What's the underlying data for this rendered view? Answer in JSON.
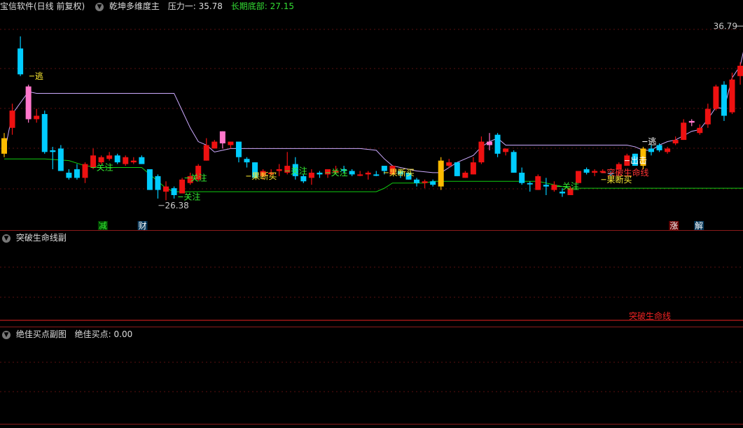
{
  "header": {
    "app_title": "宝信软件(日线 前复权)",
    "indicator_name": "乾坤多维度主",
    "pressure_label": "压力一:",
    "pressure_value": "35.78",
    "bottom_label": "长期底部:",
    "bottom_value": "27.15"
  },
  "sub1": {
    "title": "突破生命线副",
    "label": "突破生命线"
  },
  "sub2": {
    "title": "绝佳买点副图",
    "buy_label": "绝佳买点:",
    "buy_value": "0.00"
  },
  "colors": {
    "up": "#ee1111",
    "down": "#00ccff",
    "pink": "#ff77cc",
    "yellow": "#ffbb00",
    "life_line": "#11cc11",
    "upper_line": "#ccaaff",
    "pressure": "#dddddd",
    "bottom": "#33dd33",
    "guanzhu": "#33ee33",
    "guoduan": "#ffee33",
    "tupo": "#ff3333"
  },
  "chart_data": {
    "type": "candlestick",
    "y_range": [
      25.6,
      37.6
    ],
    "max_label": "36.79",
    "min_label": "26.38",
    "candles": [
      [
        29.5,
        30.4,
        30.7,
        29.3,
        "yellow"
      ],
      [
        31.0,
        32.0,
        32.4,
        30.6,
        "up"
      ],
      [
        35.6,
        34.1,
        36.3,
        34.0,
        "down"
      ],
      [
        33.4,
        31.5,
        33.5,
        31.3,
        "pink"
      ],
      [
        31.7,
        31.5,
        32.1,
        31.3,
        "up"
      ],
      [
        31.8,
        29.6,
        32.0,
        29.5,
        "down"
      ],
      [
        29.7,
        29.6,
        29.9,
        28.6,
        "down"
      ],
      [
        29.8,
        28.5,
        30.0,
        28.5,
        "down"
      ],
      [
        28.4,
        28.1,
        28.6,
        28.0,
        "down"
      ],
      [
        28.1,
        28.6,
        28.9,
        28.0,
        "down"
      ],
      [
        28.1,
        28.9,
        29.0,
        27.8,
        "up"
      ],
      [
        28.7,
        29.4,
        29.8,
        28.6,
        "up"
      ],
      [
        29.0,
        29.3,
        29.4,
        28.9,
        "up"
      ],
      [
        29.2,
        29.4,
        29.6,
        29.1,
        "up"
      ],
      [
        29.4,
        29.0,
        29.5,
        28.9,
        "down"
      ],
      [
        28.9,
        29.3,
        29.4,
        28.8,
        "up"
      ],
      [
        29.1,
        29.0,
        29.3,
        28.9,
        "up"
      ],
      [
        29.3,
        28.9,
        29.4,
        28.9,
        "down"
      ],
      [
        28.6,
        27.4,
        28.6,
        27.4,
        "down"
      ],
      [
        28.2,
        27.4,
        28.3,
        26.9,
        "down"
      ],
      [
        27.3,
        27.6,
        27.9,
        26.8,
        "up"
      ],
      [
        27.5,
        27.1,
        27.6,
        26.9,
        "down"
      ],
      [
        27.2,
        28.0,
        28.1,
        27.2,
        "up"
      ],
      [
        27.8,
        28.2,
        28.4,
        27.7,
        "up"
      ],
      [
        28.0,
        28.8,
        28.9,
        27.9,
        "up"
      ],
      [
        29.1,
        30.0,
        30.4,
        29.1,
        "up"
      ],
      [
        29.8,
        30.2,
        30.3,
        29.8,
        "up"
      ],
      [
        30.1,
        30.8,
        30.8,
        29.8,
        "pink"
      ],
      [
        30.2,
        30.0,
        30.2,
        29.8,
        "up"
      ],
      [
        30.2,
        29.3,
        30.2,
        29.0,
        "down"
      ],
      [
        29.2,
        29.0,
        29.3,
        28.7,
        "down"
      ],
      [
        29.0,
        28.1,
        29.0,
        28.1,
        "down"
      ],
      [
        28.2,
        28.5,
        28.6,
        28.0,
        "up"
      ],
      [
        28.4,
        28.4,
        28.6,
        28.2,
        "up"
      ],
      [
        28.5,
        28.6,
        28.9,
        28.2,
        "up"
      ],
      [
        28.8,
        28.4,
        29.6,
        28.3,
        "up"
      ],
      [
        28.2,
        28.9,
        29.3,
        28.0,
        "down"
      ],
      [
        28.2,
        27.9,
        28.3,
        27.8,
        "down"
      ],
      [
        28.1,
        28.4,
        28.6,
        27.7,
        "up"
      ],
      [
        28.4,
        28.3,
        28.5,
        28.1,
        "down"
      ],
      [
        28.3,
        28.6,
        28.6,
        28.1,
        "up"
      ],
      [
        28.5,
        28.5,
        28.8,
        28.3,
        "up"
      ],
      [
        28.6,
        28.5,
        28.8,
        28.4,
        "down"
      ],
      [
        28.5,
        28.3,
        28.6,
        28.2,
        "down"
      ],
      [
        28.3,
        28.3,
        28.5,
        28.2,
        "up"
      ],
      [
        28.3,
        28.4,
        28.5,
        28.0,
        "up"
      ],
      [
        28.3,
        28.3,
        28.5,
        28.2,
        "down"
      ],
      [
        28.5,
        28.8,
        28.8,
        28.3,
        "down"
      ],
      [
        28.8,
        28.3,
        28.8,
        28.3,
        "up"
      ],
      [
        28.3,
        28.5,
        28.6,
        28.1,
        "down"
      ],
      [
        28.4,
        28.0,
        28.4,
        28.0,
        "down"
      ],
      [
        28.0,
        27.8,
        28.1,
        27.6,
        "down"
      ],
      [
        27.8,
        27.9,
        28.0,
        27.5,
        "up"
      ],
      [
        27.9,
        27.7,
        28.0,
        27.6,
        "down"
      ],
      [
        27.6,
        29.1,
        29.3,
        27.4,
        "yellow"
      ],
      [
        28.8,
        29.0,
        29.2,
        28.7,
        "up"
      ],
      [
        29.0,
        28.2,
        29.0,
        28.2,
        "down"
      ],
      [
        28.1,
        28.4,
        28.5,
        28.1,
        "up"
      ],
      [
        28.3,
        29.0,
        29.3,
        28.3,
        "up"
      ],
      [
        29.0,
        30.2,
        30.5,
        28.9,
        "up"
      ],
      [
        30.2,
        30.0,
        30.7,
        29.7,
        "pink"
      ],
      [
        30.6,
        29.5,
        30.7,
        29.3,
        "down"
      ],
      [
        29.8,
        29.6,
        29.8,
        29.4,
        "up"
      ],
      [
        29.6,
        28.4,
        29.7,
        28.4,
        "down"
      ],
      [
        28.4,
        27.8,
        28.7,
        27.7,
        "down"
      ],
      [
        27.8,
        27.8,
        27.9,
        27.3,
        "down"
      ],
      [
        27.4,
        28.2,
        28.3,
        27.4,
        "up"
      ],
      [
        27.7,
        27.6,
        28.1,
        27.1,
        "down"
      ],
      [
        27.7,
        27.4,
        27.9,
        27.3,
        "up"
      ],
      [
        27.3,
        27.2,
        27.5,
        27.0,
        "down"
      ],
      [
        27.1,
        27.5,
        27.6,
        27.1,
        "up"
      ],
      [
        27.8,
        28.5,
        28.5,
        27.8,
        "up"
      ],
      [
        28.6,
        28.4,
        28.7,
        28.3,
        "down"
      ],
      [
        28.4,
        28.5,
        28.6,
        28.2,
        "up"
      ],
      [
        28.5,
        28.5,
        28.6,
        28.4,
        "up"
      ],
      [
        28.4,
        28.4,
        28.5,
        28.2,
        "down"
      ],
      [
        28.6,
        28.9,
        29.0,
        28.3,
        "up"
      ],
      [
        28.8,
        29.4,
        29.5,
        28.8,
        "up"
      ],
      [
        29.5,
        28.8,
        29.5,
        28.8,
        "down"
      ],
      [
        28.8,
        29.8,
        29.9,
        28.6,
        "yellow"
      ],
      [
        29.8,
        29.6,
        30.0,
        29.4,
        "down"
      ],
      [
        30.0,
        29.7,
        30.1,
        29.6,
        "down"
      ],
      [
        29.6,
        29.8,
        29.9,
        29.5,
        "up"
      ],
      [
        30.1,
        30.3,
        30.5,
        30.0,
        "up"
      ],
      [
        30.3,
        31.3,
        31.5,
        30.3,
        "up"
      ],
      [
        31.3,
        31.4,
        31.5,
        31.1,
        "pink"
      ],
      [
        31.0,
        30.7,
        31.2,
        30.6,
        "up"
      ],
      [
        31.2,
        32.1,
        32.4,
        31.0,
        "up"
      ],
      [
        32.1,
        33.4,
        33.5,
        32.0,
        "up"
      ],
      [
        33.5,
        31.7,
        33.7,
        31.4,
        "down"
      ],
      [
        31.9,
        33.8,
        34.2,
        31.8,
        "up"
      ],
      [
        34.0,
        34.6,
        34.8,
        33.5,
        "up"
      ],
      [
        36.2,
        36.6,
        36.8,
        35.7,
        "up"
      ]
    ],
    "life_line": [
      [
        0,
        29.2
      ],
      [
        5,
        29.2
      ],
      [
        8,
        29.1
      ],
      [
        10,
        28.8
      ],
      [
        12,
        28.7
      ],
      [
        17,
        28.7
      ],
      [
        18,
        28.3
      ],
      [
        20,
        27.5
      ],
      [
        21,
        27.3
      ],
      [
        25,
        27.3
      ],
      [
        32,
        27.3
      ],
      [
        40,
        27.3
      ],
      [
        46,
        27.3
      ],
      [
        47,
        27.5
      ],
      [
        48,
        27.8
      ],
      [
        52,
        27.8
      ],
      [
        53,
        27.9
      ],
      [
        60,
        27.9
      ],
      [
        63,
        27.9
      ],
      [
        66,
        27.9
      ],
      [
        68,
        27.7
      ],
      [
        70,
        27.5
      ],
      [
        71,
        27.5
      ],
      [
        75,
        27.5
      ],
      [
        90,
        27.5
      ],
      [
        92,
        27.5
      ]
    ],
    "upper_line": [
      [
        0,
        29.5
      ],
      [
        1,
        31.8
      ],
      [
        3,
        33.1
      ],
      [
        4,
        33.0
      ],
      [
        5,
        33.0
      ],
      [
        20,
        33.0
      ],
      [
        21,
        33.0
      ],
      [
        22,
        32.0
      ],
      [
        23,
        31.0
      ],
      [
        24,
        30.2
      ],
      [
        25,
        30.0
      ],
      [
        26,
        29.6
      ],
      [
        27,
        29.7
      ],
      [
        28,
        29.8
      ],
      [
        36,
        29.8
      ],
      [
        44,
        29.8
      ],
      [
        46,
        29.7
      ],
      [
        47,
        29.2
      ],
      [
        48,
        28.8
      ],
      [
        50,
        28.6
      ],
      [
        51,
        28.5
      ],
      [
        53,
        28.4
      ],
      [
        54,
        28.4
      ],
      [
        56,
        29.0
      ],
      [
        58,
        29.4
      ],
      [
        59,
        29.9
      ],
      [
        60,
        30.2
      ],
      [
        61,
        30.4
      ],
      [
        62,
        30.0
      ],
      [
        64,
        30.0
      ],
      [
        76,
        30.0
      ],
      [
        77,
        30.0
      ],
      [
        78,
        29.9
      ],
      [
        79,
        29.7
      ],
      [
        80,
        29.7
      ],
      [
        81,
        30.0
      ],
      [
        82,
        30.2
      ],
      [
        83,
        30.3
      ],
      [
        85,
        30.8
      ],
      [
        86,
        30.9
      ],
      [
        87,
        31.5
      ],
      [
        88,
        32.2
      ],
      [
        89,
        32.1
      ],
      [
        90,
        33.9
      ],
      [
        91,
        34.6
      ],
      [
        92,
        36.7
      ]
    ],
    "annotations": [
      {
        "text": "逃",
        "x": 3.8,
        "y": 34.0,
        "color": "#ffee33"
      },
      {
        "text": "关注",
        "x": 11.4,
        "y": 28.7,
        "color": "#33ee33"
      },
      {
        "text": "关注",
        "x": 23.0,
        "y": 28.1,
        "color": "#33ee33"
      },
      {
        "text": "关注",
        "x": 22.2,
        "y": 27.0,
        "color": "#33ee33"
      },
      {
        "text": "果断买",
        "x": 30.6,
        "y": 28.2,
        "color": "#ffee33"
      },
      {
        "text": "关注",
        "x": 35.4,
        "y": 28.5,
        "color": "#33ee33"
      },
      {
        "text": "关注",
        "x": 40.4,
        "y": 28.4,
        "color": "#33ee33"
      },
      {
        "text": "果断买",
        "x": 47.6,
        "y": 28.4,
        "color": "#ffee33"
      },
      {
        "text": "关注",
        "x": 69.0,
        "y": 27.6,
        "color": "#33ee33"
      },
      {
        "text": "突破生命线",
        "x": 74.5,
        "y": 28.4,
        "color": "#ff3333"
      },
      {
        "text": "果断买",
        "x": 74.5,
        "y": 28.0,
        "color": "#ffee33"
      },
      {
        "text": "出击",
        "x": 77.4,
        "y": 29.1,
        "color": "#ffffff"
      },
      {
        "text": "逃",
        "x": 79.6,
        "y": 30.2,
        "color": "#ffffff"
      }
    ],
    "bottom_markers": [
      {
        "text": "减",
        "x": 12.2,
        "color": "#33ee33",
        "bg": "#004400"
      },
      {
        "text": "财",
        "x": 17.1,
        "color": "#ffffff",
        "bg": "#003355"
      },
      {
        "text": "涨",
        "x": 82.8,
        "color": "#ffffff",
        "bg": "#660000"
      },
      {
        "text": "解",
        "x": 85.9,
        "color": "#ffffff",
        "bg": "#003355"
      }
    ]
  }
}
